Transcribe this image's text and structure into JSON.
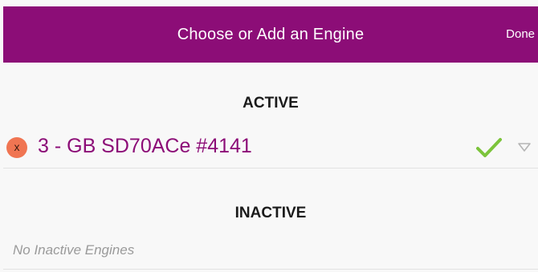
{
  "header": {
    "title": "Choose or Add an Engine",
    "done_label": "Done"
  },
  "active": {
    "heading": "ACTIVE",
    "engines": [
      {
        "name": "3 - GB SD70ACe #4141",
        "remove_label": "x",
        "selected": true
      }
    ]
  },
  "inactive": {
    "heading": "INACTIVE",
    "empty_message": "No Inactive Engines"
  },
  "colors": {
    "header_bg": "#8c0d77",
    "engine_text": "#8c0d77",
    "remove_button": "#f07552",
    "check_mark": "#7cc43b"
  },
  "icons": {
    "remove": "close-icon",
    "selected": "checkmark-icon",
    "expand": "triangle-down-icon"
  }
}
